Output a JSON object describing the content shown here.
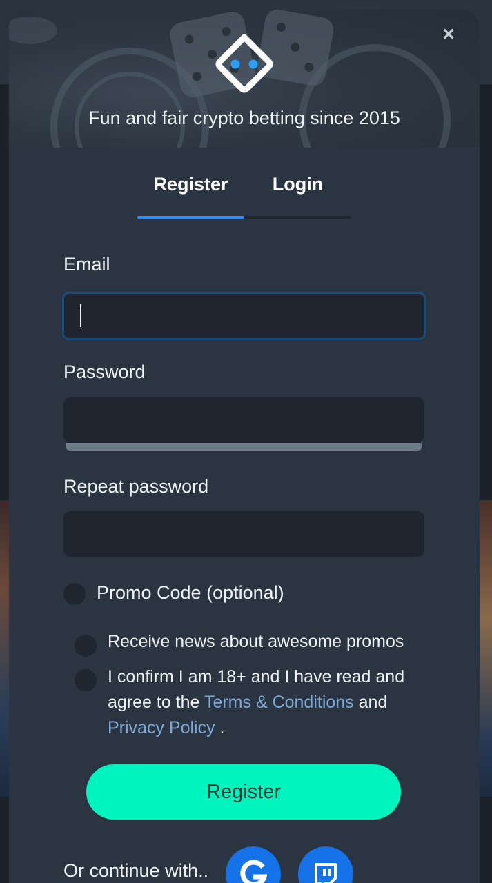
{
  "header": {
    "tagline": "Fun and fair crypto betting since 2015",
    "close_icon": "close-icon",
    "logo_icon": "logo-icon"
  },
  "tabs": [
    {
      "label": "Register",
      "active": true
    },
    {
      "label": "Login",
      "active": false
    }
  ],
  "form": {
    "email_label": "Email",
    "email_value": "",
    "password_label": "Password",
    "password_value": "",
    "repeat_label": "Repeat password",
    "repeat_value": "",
    "promo_label": "Promo Code (optional)",
    "news_label": "Receive news about awesome promos",
    "terms_prefix": "I confirm I am 18+ and I have read and agree to the ",
    "terms_link": "Terms & Conditions",
    "terms_mid": " and ",
    "privacy_link": "Privacy Policy",
    "terms_suffix": " .",
    "submit_label": "Register"
  },
  "social": {
    "label": "Or continue with..",
    "providers": [
      "google-icon",
      "twitch-icon"
    ]
  },
  "colors": {
    "accent": "#00f5be",
    "tab_active": "#2a8bf2",
    "link": "#7fa8d6",
    "social_button": "#1672e8"
  }
}
